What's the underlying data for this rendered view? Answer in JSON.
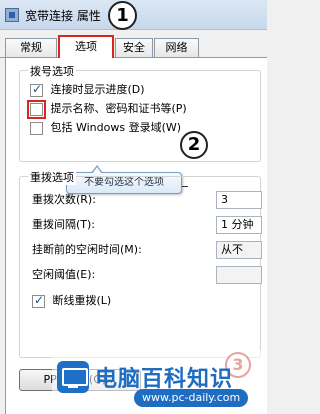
{
  "window": {
    "title": "宽带连接 属性"
  },
  "callouts": {
    "one": "1",
    "two": "2",
    "three": "3"
  },
  "tabs": [
    {
      "label": "常规"
    },
    {
      "label": "选项"
    },
    {
      "label": "安全"
    },
    {
      "label": "网络"
    }
  ],
  "dial_options": {
    "group_label": "拨号选项",
    "items": [
      {
        "label": "连接时显示进度(D)",
        "checked": true
      },
      {
        "label": "提示名称、密码和证书等(P)",
        "checked": false
      },
      {
        "label": "包括 Windows 登录域(W)",
        "checked": false
      }
    ]
  },
  "tooltip": {
    "text": "不要勾选这个选项"
  },
  "redial_options": {
    "group_label": "重拨选项",
    "fields": [
      {
        "label": "重拨次数(R):",
        "value": "3"
      },
      {
        "label": "重拨间隔(T):",
        "value": "1 分钟"
      },
      {
        "label": "挂断前的空闲时间(M):",
        "value": "从不"
      },
      {
        "label": "空闲阈值(E):",
        "value": ""
      }
    ],
    "redial_checkbox": {
      "label": "断线重拨(L)",
      "checked": true
    }
  },
  "ppp_button": {
    "label": "PPP 设置(G)..."
  },
  "watermark": {
    "brand": "电脑百科知识",
    "url": "www.pc-daily.com"
  },
  "colors": {
    "highlight_red": "#d7261b",
    "brand_blue": "#1f6cc3"
  }
}
